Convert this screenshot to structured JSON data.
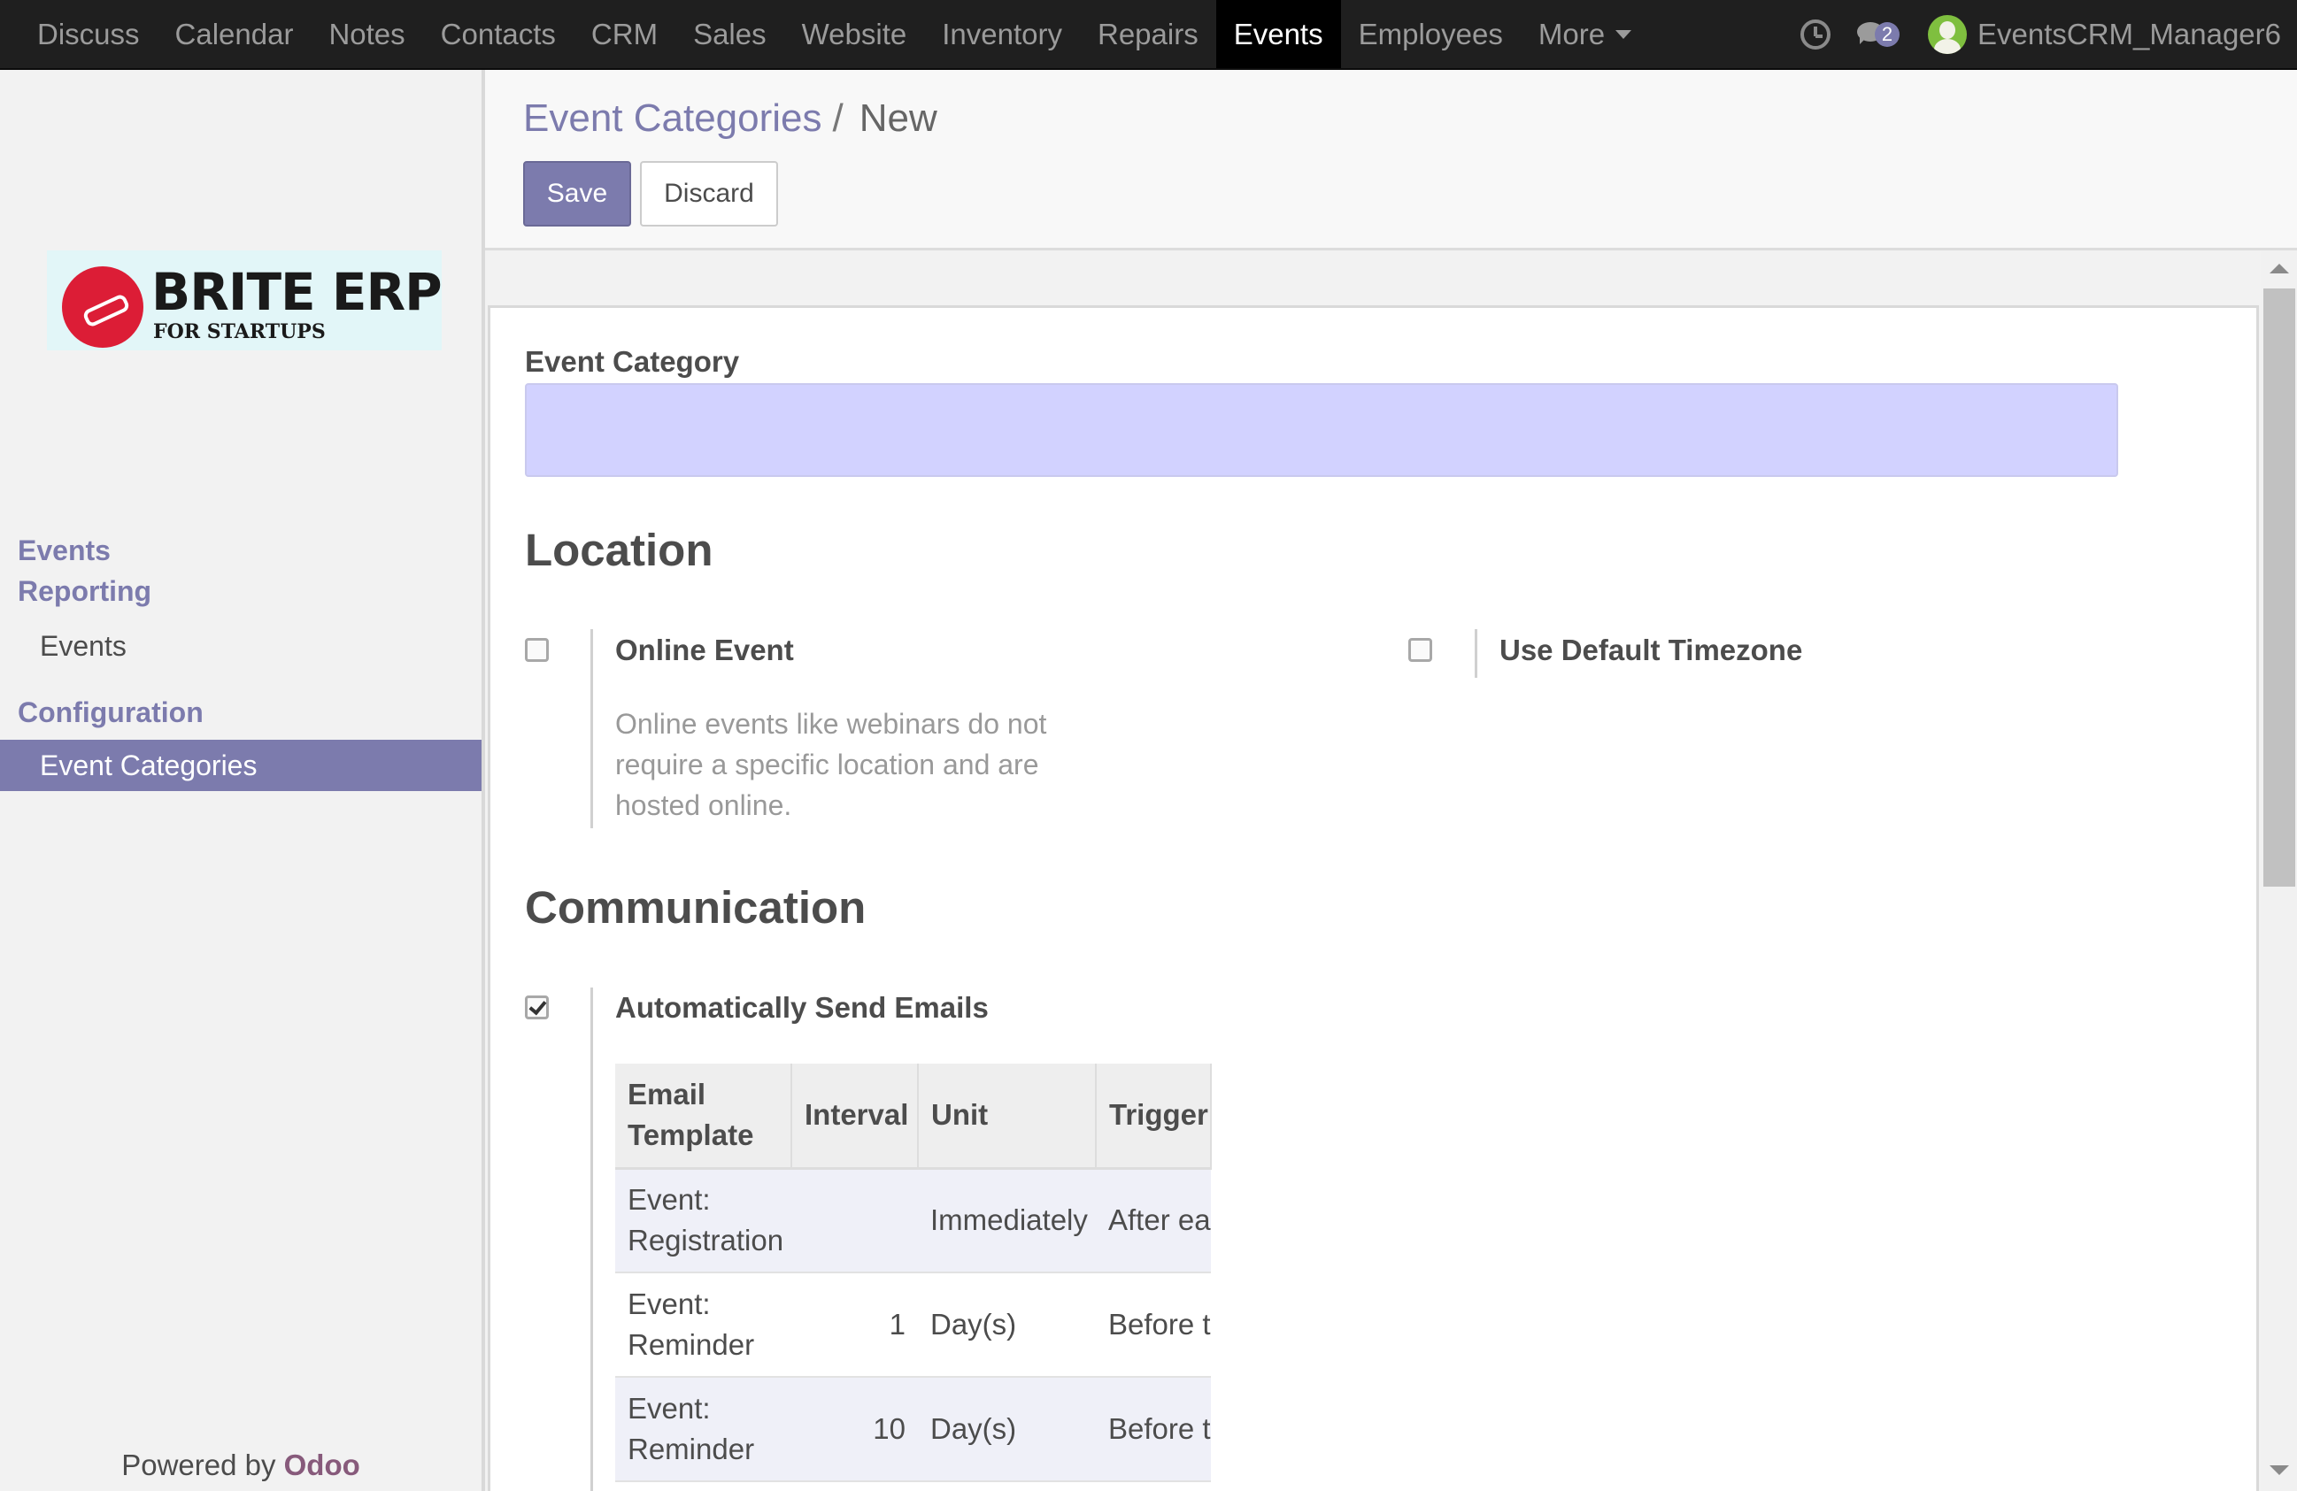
{
  "navbar": {
    "menu": [
      {
        "label": "Discuss"
      },
      {
        "label": "Calendar"
      },
      {
        "label": "Notes"
      },
      {
        "label": "Contacts"
      },
      {
        "label": "CRM"
      },
      {
        "label": "Sales"
      },
      {
        "label": "Website"
      },
      {
        "label": "Inventory"
      },
      {
        "label": "Repairs"
      },
      {
        "label": "Events"
      },
      {
        "label": "Employees"
      },
      {
        "label": "More"
      }
    ],
    "active": "Events",
    "messages_count": "2",
    "user_name": "EventsCRM_Manager6"
  },
  "sidebar": {
    "logo": {
      "title": "BRITE ERP",
      "subtitle": "FOR STARTUPS"
    },
    "sections": [
      {
        "heading": "Events"
      },
      {
        "heading": "Reporting",
        "items": [
          {
            "label": "Events"
          }
        ]
      },
      {
        "heading": "Configuration",
        "items": [
          {
            "label": "Event Categories",
            "active": true
          }
        ]
      }
    ],
    "powered_prefix": "Powered by",
    "powered_brand": "Odoo"
  },
  "control_panel": {
    "breadcrumb_parent": "Event Categories",
    "breadcrumb_separator": "/",
    "breadcrumb_current": "New",
    "save_label": "Save",
    "discard_label": "Discard"
  },
  "form": {
    "name_label": "Event Category",
    "name_value": "",
    "location_title": "Location",
    "online_event_label": "Online Event",
    "online_event_checked": false,
    "online_event_help": "Online events like webinars do not require a specific location and are hosted online.",
    "default_timezone_label": "Use Default Timezone",
    "default_timezone_checked": false,
    "communication_title": "Communication",
    "auto_emails_label": "Automatically Send Emails",
    "auto_emails_checked": true,
    "table": {
      "headers": [
        "Email Template",
        "Interval",
        "Unit",
        "Trigger"
      ],
      "rows": [
        {
          "template": "Event: Registration",
          "interval": "",
          "unit": "Immediately",
          "trigger": "After each registration"
        },
        {
          "template": "Event: Reminder",
          "interval": "1",
          "unit": "Day(s)",
          "trigger": "Before the event"
        },
        {
          "template": "Event: Reminder",
          "interval": "10",
          "unit": "Day(s)",
          "trigger": "Before the event"
        }
      ]
    }
  },
  "colors": {
    "accent": "#7c7bad",
    "navbar_bg": "#1f1f1f",
    "required_field_bg": "#d2d2ff",
    "brand_odoo": "#875a7b"
  }
}
